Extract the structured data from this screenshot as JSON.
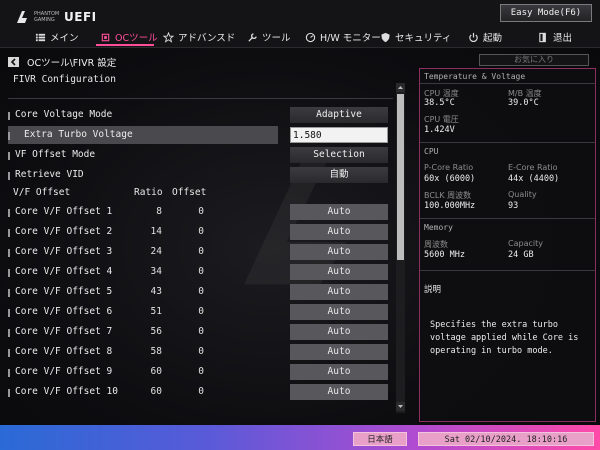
{
  "header": {
    "brand_small": "PHANTOM GAMING",
    "brand_uefi": "UEFI",
    "easy_mode_label": "Easy Mode(F6)"
  },
  "nav": {
    "items": [
      {
        "label": "メイン",
        "icon": "list-icon"
      },
      {
        "label": "OCツール",
        "icon": "cpu-icon",
        "active": true
      },
      {
        "label": "アドバンスド",
        "icon": "star-icon"
      },
      {
        "label": "ツール",
        "icon": "wrench-icon"
      },
      {
        "label": "H/W モニター",
        "icon": "monitor-icon"
      },
      {
        "label": "セキュリティ",
        "icon": "shield-icon"
      },
      {
        "label": "起動",
        "icon": "power-icon"
      },
      {
        "label": "退出",
        "icon": "exit-icon"
      }
    ]
  },
  "breadcrumb": "OCツール\\FIVR 設定",
  "favorites_label": "お気に入り",
  "main": {
    "section_title": "FIVR Configuration",
    "settings": [
      {
        "label": "Core Voltage Mode",
        "value": "Adaptive"
      },
      {
        "label": "Extra Turbo Voltage",
        "value": "1.580"
      },
      {
        "label": "VF Offset Mode",
        "value": "Selection"
      },
      {
        "label": "Retrieve VID",
        "value": "自動"
      }
    ],
    "table_header": {
      "label": "V/F Offset",
      "ratio": "Ratio",
      "offset": "Offset"
    },
    "offset_rows": [
      {
        "label": "Core V/F Offset 1",
        "ratio": "8",
        "offset": "0",
        "value": "Auto"
      },
      {
        "label": "Core V/F Offset 2",
        "ratio": "14",
        "offset": "0",
        "value": "Auto"
      },
      {
        "label": "Core V/F Offset 3",
        "ratio": "24",
        "offset": "0",
        "value": "Auto"
      },
      {
        "label": "Core V/F Offset 4",
        "ratio": "34",
        "offset": "0",
        "value": "Auto"
      },
      {
        "label": "Core V/F Offset 5",
        "ratio": "43",
        "offset": "0",
        "value": "Auto"
      },
      {
        "label": "Core V/F Offset 6",
        "ratio": "51",
        "offset": "0",
        "value": "Auto"
      },
      {
        "label": "Core V/F Offset 7",
        "ratio": "56",
        "offset": "0",
        "value": "Auto"
      },
      {
        "label": "Core V/F Offset 8",
        "ratio": "58",
        "offset": "0",
        "value": "Auto"
      },
      {
        "label": "Core V/F Offset 9",
        "ratio": "60",
        "offset": "0",
        "value": "Auto"
      },
      {
        "label": "Core V/F Offset 10",
        "ratio": "60",
        "offset": "0",
        "value": "Auto"
      }
    ]
  },
  "info": {
    "temp_title": "Temperature & Voltage",
    "cpu_temp_label": "CPU 温度",
    "cpu_temp_value": "38.5°C",
    "mb_temp_label": "M/B 温度",
    "mb_temp_value": "39.0°C",
    "cpu_voltage_label": "CPU 電圧",
    "cpu_voltage_value": "1.424V",
    "cpu_title": "CPU",
    "pcore_label": "P-Core Ratio",
    "pcore_value": "60x (6000)",
    "ecore_label": "E-Core Ratio",
    "ecore_value": "44x (4400)",
    "bclk_label": "BCLK 周波数",
    "bclk_value": "100.000MHz",
    "quality_label": "Quality",
    "quality_value": "93",
    "memory_title": "Memory",
    "freq_label": "周波数",
    "freq_value": "5600 MHz",
    "capacity_label": "Capacity",
    "capacity_value": "24 GB",
    "desc_title": "説明",
    "desc_text": "Specifies the extra turbo voltage applied while Core is operating in turbo mode."
  },
  "footer": {
    "language": "日本語",
    "datetime": "Sat 02/10/2024. 18:10:16"
  },
  "colors": {
    "accent": "#ff4f9a",
    "panel_border": "#8b2f62",
    "selected_row": "#4a4a4e"
  }
}
